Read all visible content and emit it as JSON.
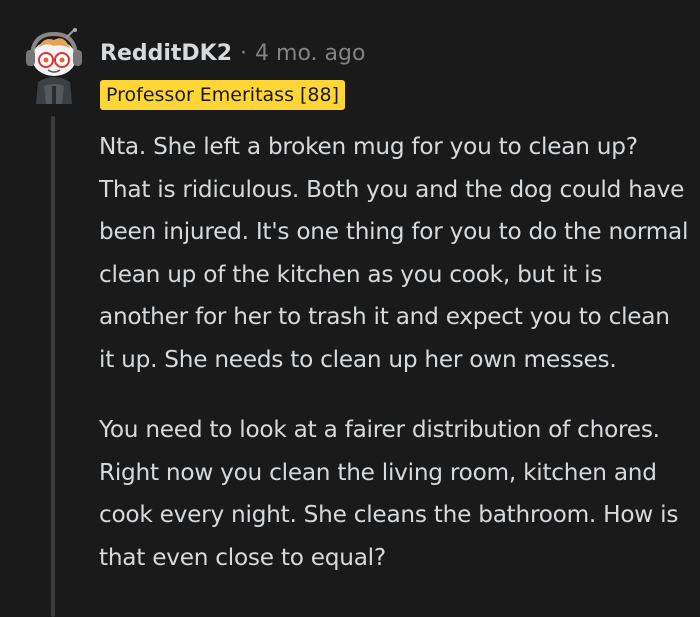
{
  "comment": {
    "username": "RedditDK2",
    "separator": "·",
    "timestamp": "4 mo. ago",
    "flair": "Professor Emeritass [88]",
    "avatar_icon": "snoo-avatar-icon",
    "paragraphs": [
      "Nta. She left a broken mug for you to clean up? That is ridiculous. Both you and the dog could have been injured. It's one thing for you to do the normal clean up of the kitchen as you cook, but it is another for her to trash it and expect you to clean it up. She needs to clean up her own messes.",
      "You need to look at a fairer distribution of chores. Right now you clean the living room, kitchen and cook every night. She cleans the bathroom. How is that even close to equal?"
    ]
  },
  "colors": {
    "background": "#1a1a1b",
    "text": "#d7dadc",
    "muted": "#818384",
    "flair_bg": "#ffd635",
    "thread_line": "#3a3a3c"
  }
}
